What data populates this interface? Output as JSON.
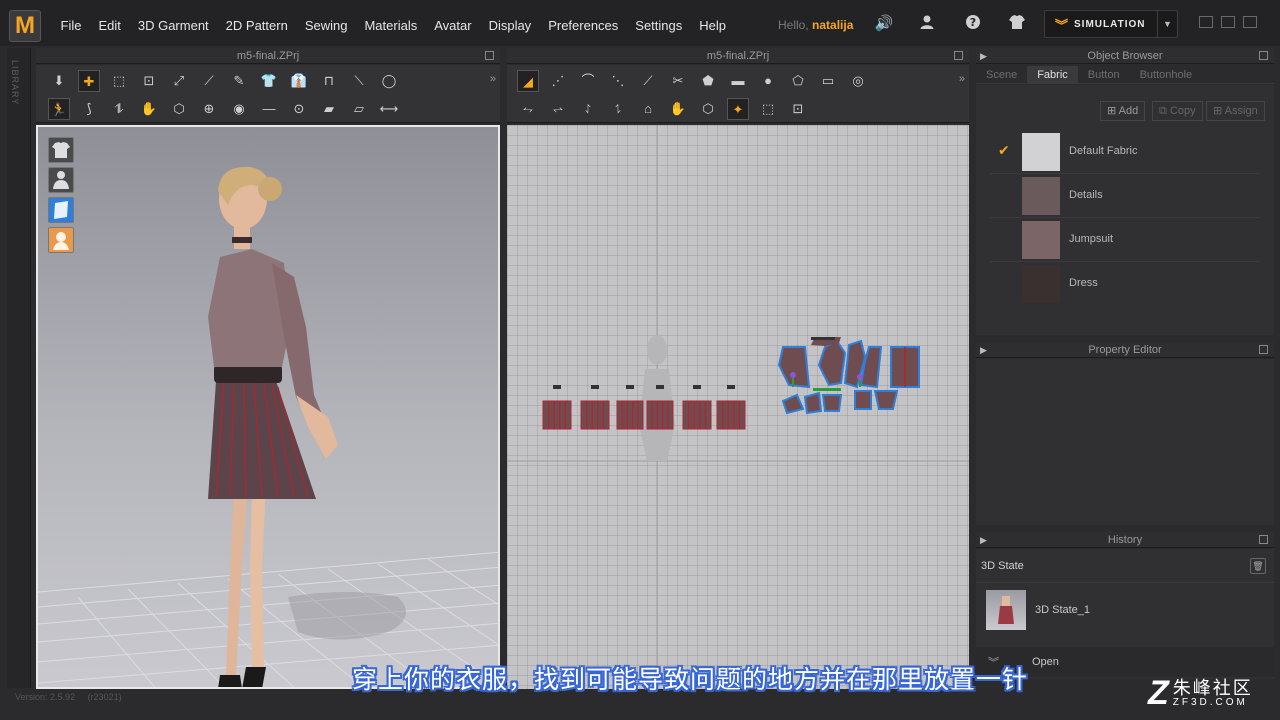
{
  "app": {
    "logo_letter": "M",
    "menu": [
      "File",
      "Edit",
      "3D Garment",
      "2D Pattern",
      "Sewing",
      "Materials",
      "Avatar",
      "Display",
      "Preferences",
      "Settings",
      "Help"
    ],
    "hello_prefix": "Hello,",
    "user": "natalija",
    "simulation_label": "SIMULATION",
    "library_label": "LIBRARY"
  },
  "viewport3d": {
    "title": "m5-final.ZPrj"
  },
  "viewport2d": {
    "title": "m5-final.ZPrj"
  },
  "object_browser": {
    "title": "Object Browser",
    "tabs": [
      "Scene",
      "Fabric",
      "Button",
      "Buttonhole"
    ],
    "active_tab": "Fabric",
    "buttons": {
      "add": "Add",
      "copy": "Copy",
      "assign": "Assign"
    },
    "fabrics": [
      {
        "name": "Default Fabric",
        "color": "#d2d2d4",
        "checked": true
      },
      {
        "name": "Details",
        "color": "#6b5a5b",
        "checked": false
      },
      {
        "name": "Jumpsuit",
        "color": "#7c6567",
        "checked": false
      },
      {
        "name": "Dress",
        "color": "#3a302f",
        "checked": false
      }
    ]
  },
  "property_editor": {
    "title": "Property Editor"
  },
  "history": {
    "title": "History",
    "state_header": "3D State",
    "states": [
      "3D State_1"
    ],
    "open_label": "Open"
  },
  "status": {
    "version": "Version: 2.5.92",
    "build": "(r23021)"
  },
  "subtitle": "穿上你的衣服，找到可能导致问题的地方并在那里放置一针",
  "watermark": {
    "name": "朱峰社区",
    "domain": "ZF3D.COM"
  },
  "colors": {
    "accent": "#f5a623",
    "pattern_fill": "#6e4c50",
    "pattern_stripe": "#b3232f",
    "selected_outline": "#2f7fd8"
  }
}
